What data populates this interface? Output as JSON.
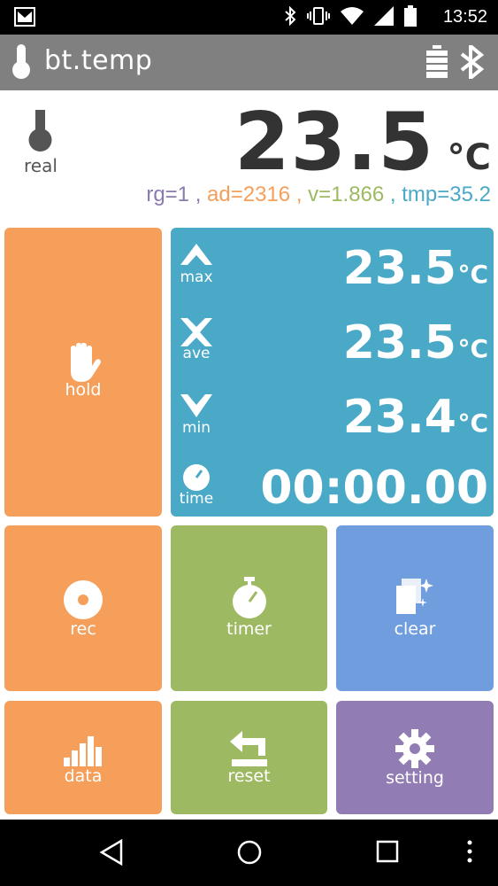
{
  "status_bar": {
    "time": "13:52"
  },
  "app_bar": {
    "title": "bt.temp"
  },
  "reading": {
    "value": "23.5",
    "unit": "°C",
    "mode_label": "real",
    "info": [
      {
        "text": "rg=1",
        "color": "#8a7ab0"
      },
      {
        "text": " , ",
        "color": "#8a7ab0"
      },
      {
        "text": "ad=2316",
        "color": "#f59f5a"
      },
      {
        "text": " , ",
        "color": "#f59f5a"
      },
      {
        "text": "v=1.866",
        "color": "#9dba62"
      },
      {
        "text": " , ",
        "color": "#4aa9c7"
      },
      {
        "text": "tmp=35.2",
        "color": "#4aa9c7"
      }
    ]
  },
  "stats": {
    "max": {
      "label": "max",
      "value": "23.5",
      "unit": "°C"
    },
    "ave": {
      "label": "ave",
      "value": "23.5",
      "unit": "°C"
    },
    "min": {
      "label": "min",
      "value": "23.4",
      "unit": "°C"
    },
    "time": {
      "label": "time",
      "value": "00:00.00"
    }
  },
  "tiles": {
    "hold": "hold",
    "rec": "rec",
    "timer": "timer",
    "clear": "clear",
    "data": "data",
    "reset": "reset",
    "setting": "setting"
  },
  "colors": {
    "orange": "#f59f5a",
    "green": "#9dba62",
    "blue": "#6f9ddd",
    "purple": "#927cb4",
    "cyan": "#4aa9c7"
  }
}
